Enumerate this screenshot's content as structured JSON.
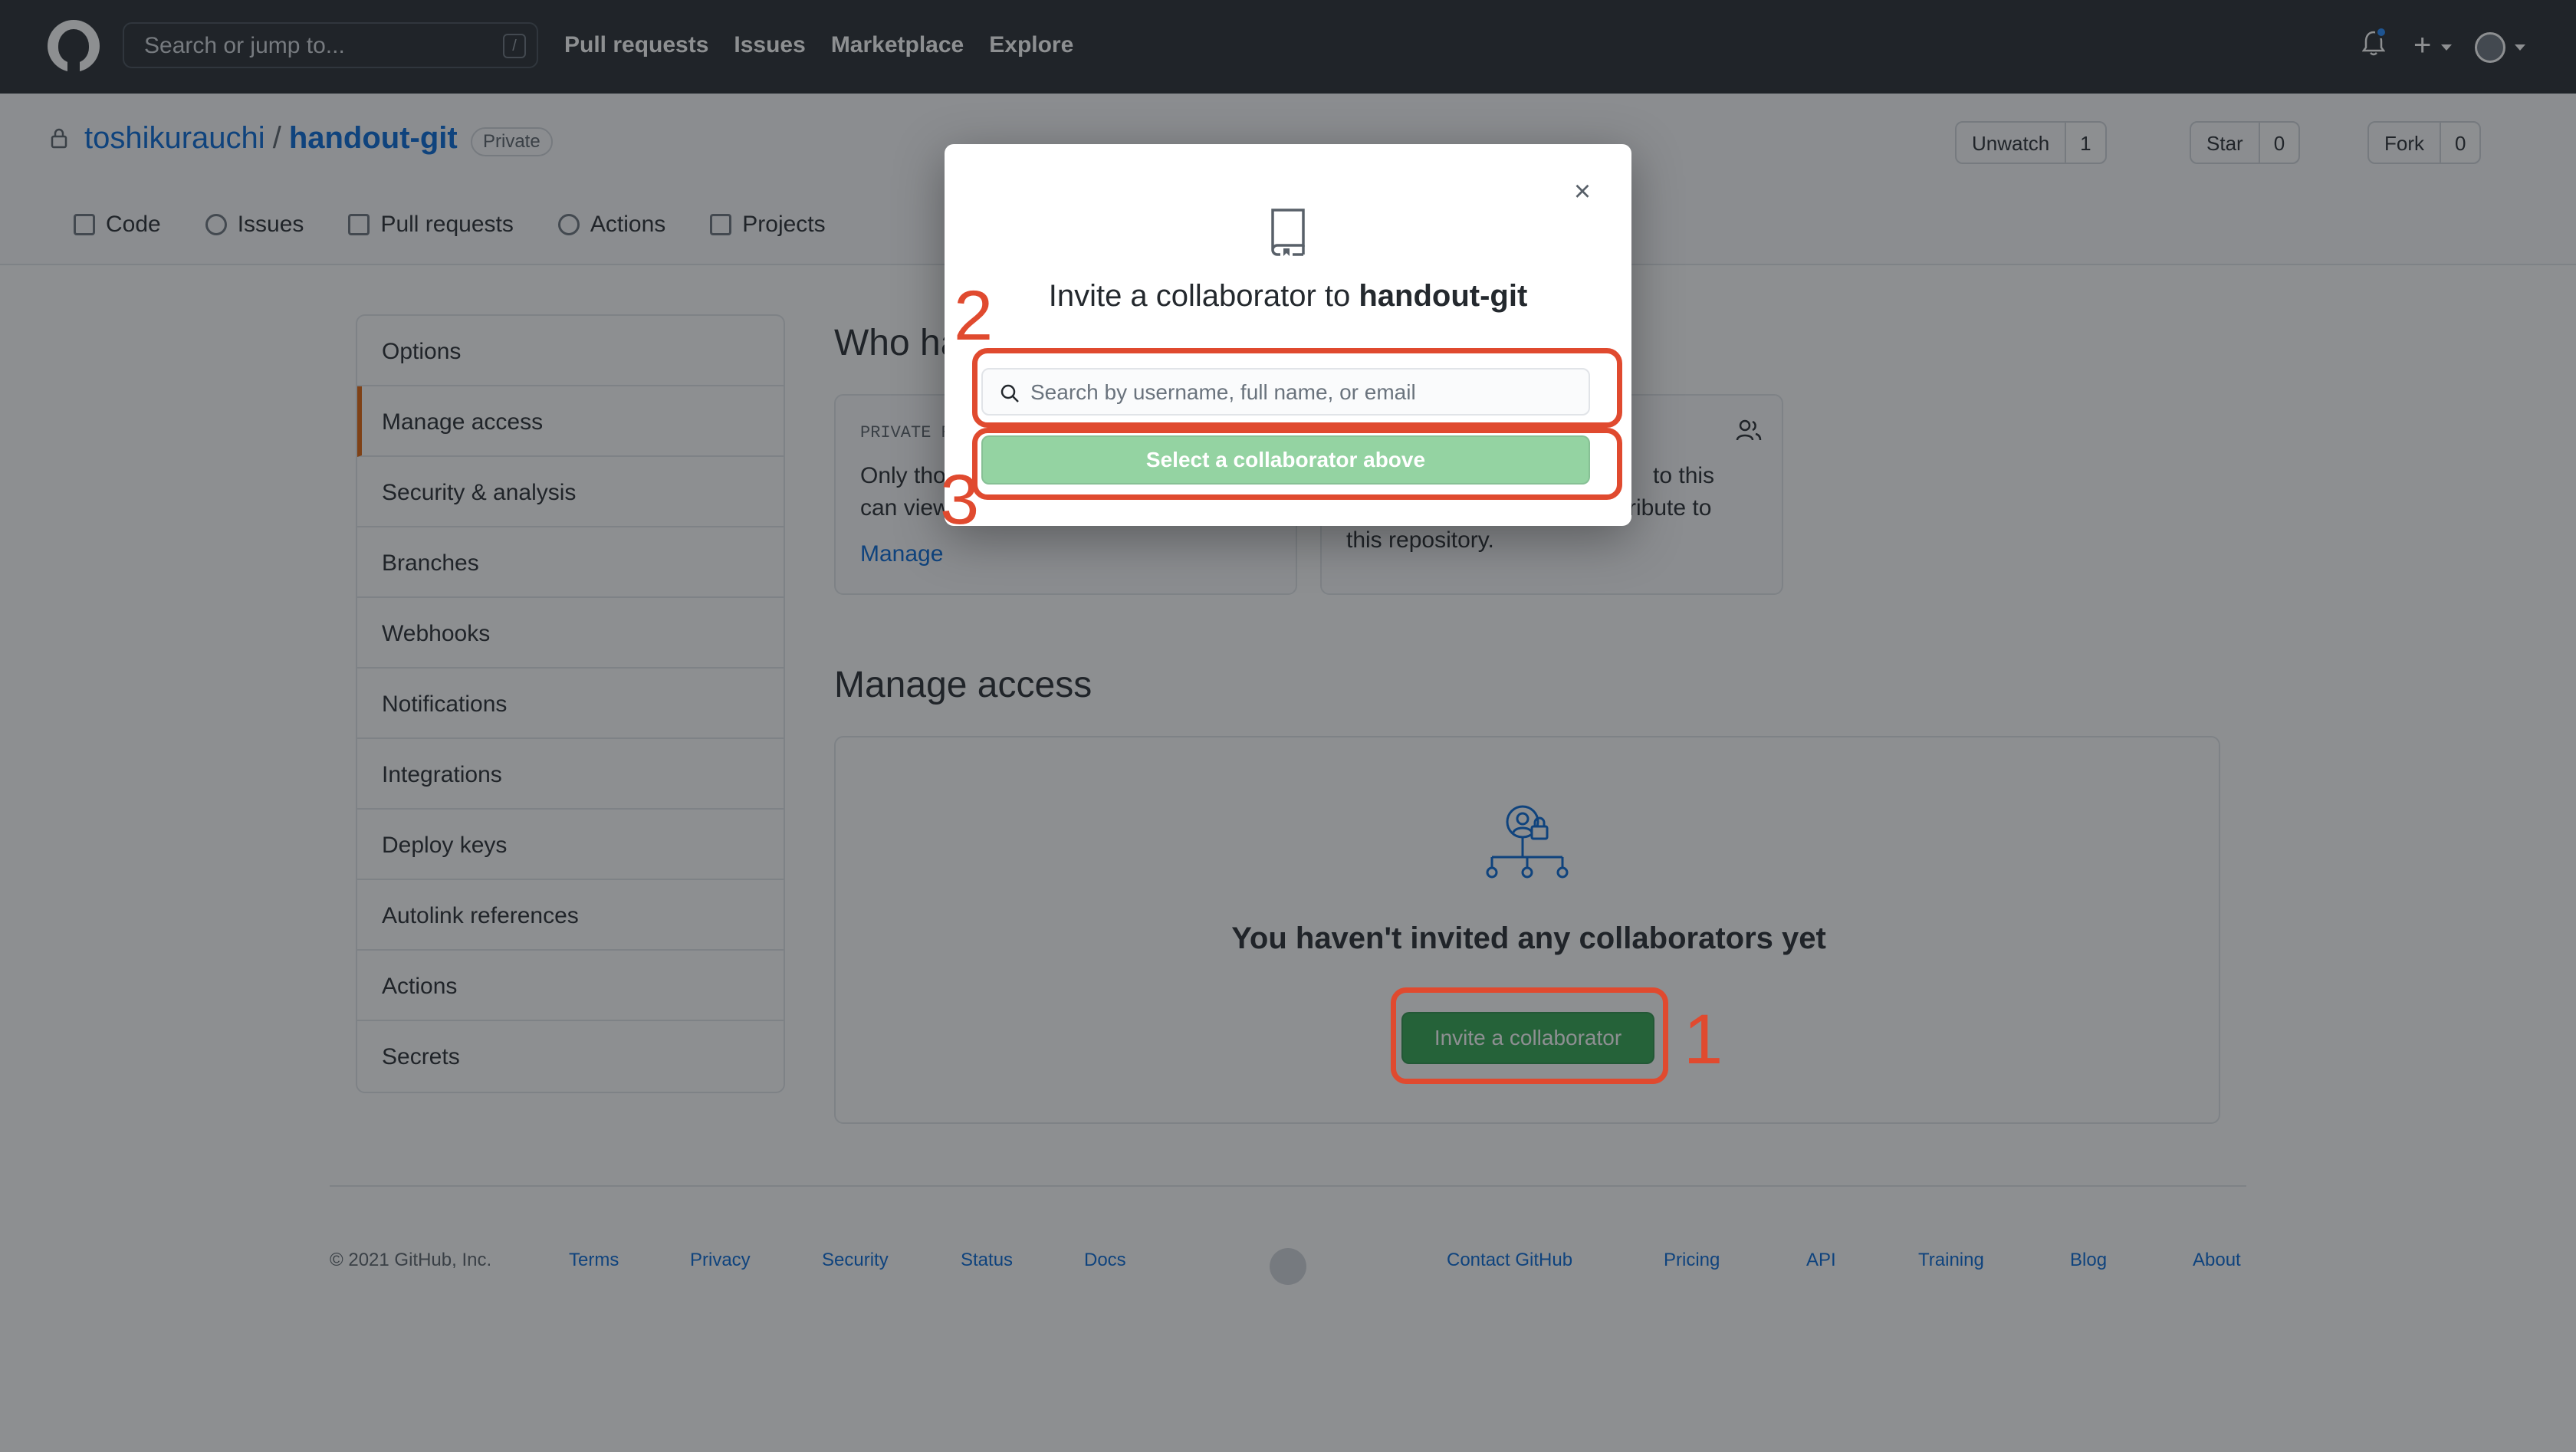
{
  "header": {
    "search_placeholder": "Search or jump to...",
    "search_key": "/",
    "nav": [
      "Pull requests",
      "Issues",
      "Marketplace",
      "Explore"
    ],
    "icons": [
      "github-logo",
      "bell-icon",
      "plus-icon",
      "avatar"
    ]
  },
  "repo": {
    "owner": "toshikurauchi",
    "separator": "/",
    "name": "handout-git",
    "visibility": "Private",
    "watch_label": "Unwatch",
    "watch_count": "1",
    "star_label": "Star",
    "star_count": "0",
    "fork_label": "Fork",
    "fork_count": "0",
    "tabs": [
      "Code",
      "Issues",
      "Pull requests",
      "Actions",
      "Projects"
    ]
  },
  "sidebar": {
    "items": [
      "Options",
      "Manage access",
      "Security & analysis",
      "Branches",
      "Webhooks",
      "Notifications",
      "Integrations",
      "Deploy keys",
      "Autolink references",
      "Actions",
      "Secrets"
    ],
    "selected": "Manage access"
  },
  "main": {
    "who_heading": "Who ha",
    "private_box": {
      "kicker": "PRIVATE R",
      "desc_line1": "Only tho",
      "desc_line2": "can view",
      "link": "Manage"
    },
    "collab_box": {
      "desc_line1": "to this",
      "desc_line2": "ribute to",
      "desc_line3": "this repository."
    },
    "manage_heading": "Manage access",
    "empty_title": "You haven't invited any collaborators yet",
    "invite_button": "Invite a collaborator"
  },
  "modal": {
    "title_prefix": "Invite a collaborator to ",
    "title_repo": "handout-git",
    "search_placeholder": "Search by username, full name, or email",
    "search_value": "",
    "select_button": "Select a collaborator above",
    "close_symbol": "×"
  },
  "annotations": {
    "step1": "1",
    "step2": "2",
    "step3": "3",
    "color": "#e04a2f"
  },
  "footer": {
    "copyright": "© 2021 GitHub, Inc.",
    "left_links": [
      "Terms",
      "Privacy",
      "Security",
      "Status",
      "Docs"
    ],
    "right_links": [
      "Contact GitHub",
      "Pricing",
      "API",
      "Training",
      "Blog",
      "About"
    ]
  },
  "colors": {
    "header_bg": "#24292e",
    "link": "#0366d6",
    "primary_button": "#2ea44f",
    "disabled_button": "#94d3a2",
    "overlay": "rgba(27,31,35,0.5)"
  }
}
